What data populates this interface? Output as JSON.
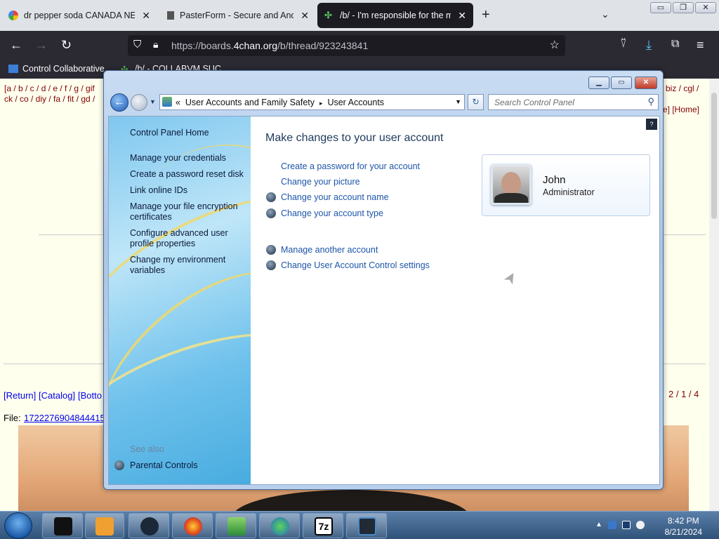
{
  "browser": {
    "tabs": [
      {
        "title": "dr pepper soda CANADA NEAR",
        "favicon": "google-icon",
        "active": false
      },
      {
        "title": "PasterForm - Secure and Anony",
        "favicon": "document-icon",
        "active": false
      },
      {
        "title": "/b/ - I'm responsible for the ma",
        "favicon": "4chan-clover-icon",
        "active": true
      }
    ],
    "new_tab_label": "+",
    "url_prefix": "https://boards.",
    "url_domain": "4chan.org",
    "url_path": "/b/thread/923243841",
    "bookmarks": [
      {
        "label": "Control Collaborative"
      },
      {
        "label": "/b/ - COLLABVM SUC"
      }
    ]
  },
  "page": {
    "board_links_line1": "[a / b / c / d / e / f / g / gif",
    "board_links_line2": "ck / co / diy / fa / fit / gd /",
    "board_links_right1": "biz / cgl /",
    "board_links_right2": "e] [Home]",
    "nav_return": "[Return]",
    "nav_catalog": "[Catalog]",
    "nav_bottom": "[Botto",
    "pages": "2 / 1 / 4",
    "file_label": "File:",
    "file_name": "1722276904844415"
  },
  "control_panel": {
    "breadcrumb_prefix": "«",
    "breadcrumb_1": "User Accounts and Family Safety",
    "breadcrumb_sep": "▸",
    "breadcrumb_2": "User Accounts",
    "search_placeholder": "Search Control Panel",
    "left_links": [
      "Control Panel Home",
      "Manage your credentials",
      "Create a password reset disk",
      "Link online IDs",
      "Manage your file encryption certificates",
      "Configure advanced user profile properties",
      "Change my environment variables"
    ],
    "see_also_label": "See also",
    "see_also_link": "Parental Controls",
    "main_title": "Make changes to your user account",
    "actions": [
      "Create a password for your account",
      "Change your picture",
      "Change your account name",
      "Change your account type"
    ],
    "more_actions": [
      "Manage another account",
      "Change User Account Control settings"
    ],
    "user_name": "John",
    "user_role": "Administrator"
  },
  "taskbar": {
    "time": "8:42 PM",
    "date": "8/21/2024",
    "apps": [
      "terminal-icon",
      "media-player-icon",
      "steam-icon",
      "firefox-icon",
      "file-manager-icon",
      "download-manager-icon",
      "7zip-icon",
      "remote-desktop-icon"
    ],
    "app_7zip_label": "7z"
  }
}
